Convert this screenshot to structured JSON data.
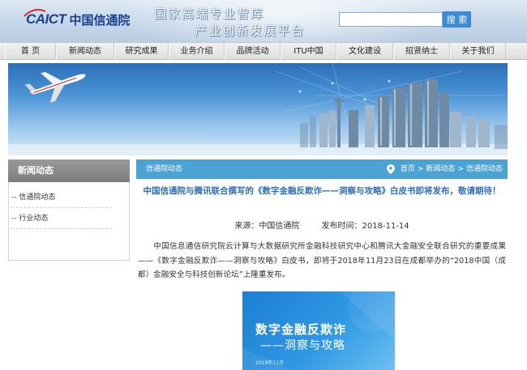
{
  "header": {
    "logo_mark": "CAICT",
    "logo_cn": "中国信通院",
    "slogan_line1": "国家高端专业智库",
    "slogan_line2": "产业创新发展平台",
    "search_placeholder": "",
    "search_button": "搜 索"
  },
  "nav": {
    "items": [
      "首 页",
      "新闻动态",
      "研究成果",
      "业务介绍",
      "品牌活动",
      "ITU中国",
      "文化建设",
      "招贤纳士",
      "关于我们"
    ]
  },
  "sidebar": {
    "heading": "新闻动态",
    "items": [
      "-- 信通院动态",
      "-- 行业动态"
    ]
  },
  "breadcrumb": {
    "section": "信通院动态",
    "path": [
      "首页",
      ">",
      "新闻动态",
      ">",
      "信通院动态"
    ]
  },
  "article": {
    "title": "中国信通院与腾讯联合撰写的《数字金融反欺诈——洞察与攻略》白皮书即将发布，敬请期待！",
    "source": "来源：中国信通院",
    "date": "发布时间：2018-11-14",
    "body": "中国信息通信研究院云计算与大数据研究所金融科技研究中心和腾讯大金融安全联合研究的重要成果——《数字金融反欺诈——洞察与攻略》白皮书，即将于2018年11月23日在成都举办的“2018中国（成都）金融安全与科技创新论坛”上隆重发布。",
    "cover_title": "数字金融反欺诈",
    "cover_subtitle": "——洞察与攻略",
    "cover_date": "2018年11月"
  },
  "colors": {
    "brand_blue": "#1a3f8f",
    "accent_blue": "#4aa3d3",
    "title_blue": "#2f6fb8"
  }
}
